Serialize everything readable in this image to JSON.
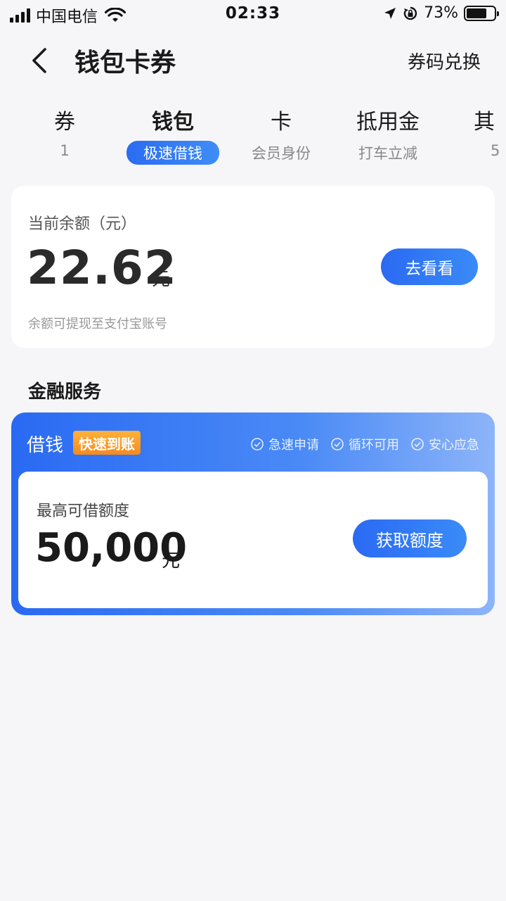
{
  "status_bar": {
    "carrier": "中国电信",
    "time": "02:33",
    "battery": "73%",
    "battery_level": 0.73
  },
  "header": {
    "title": "钱包卡券",
    "redeem": "券码兑换",
    "back_icon": "chevron-left-icon"
  },
  "tabs": [
    {
      "label": "券",
      "sub": "1"
    },
    {
      "label": "钱包",
      "sub": "极速借钱",
      "active": true
    },
    {
      "label": "卡",
      "sub": "会员身份"
    },
    {
      "label": "抵用金",
      "sub": "打车立减"
    },
    {
      "label": "其",
      "sub": "5"
    }
  ],
  "balance": {
    "label": "当前余额（元）",
    "amount": "22.62",
    "unit": "元",
    "button": "去看看",
    "note": "余额可提现至支付宝账号"
  },
  "section": {
    "title": "金融服务"
  },
  "loan": {
    "title": "借钱",
    "badge": "快速到账",
    "features": [
      "急速申请",
      "循环可用",
      "安心应急"
    ],
    "limit_label": "最高可借额度",
    "limit_amount": "50,000",
    "limit_unit": "元",
    "button": "获取额度"
  },
  "colors": {
    "accent": "#2a6af3",
    "badge": "#f58a1f",
    "background": "#f6f6f8"
  }
}
